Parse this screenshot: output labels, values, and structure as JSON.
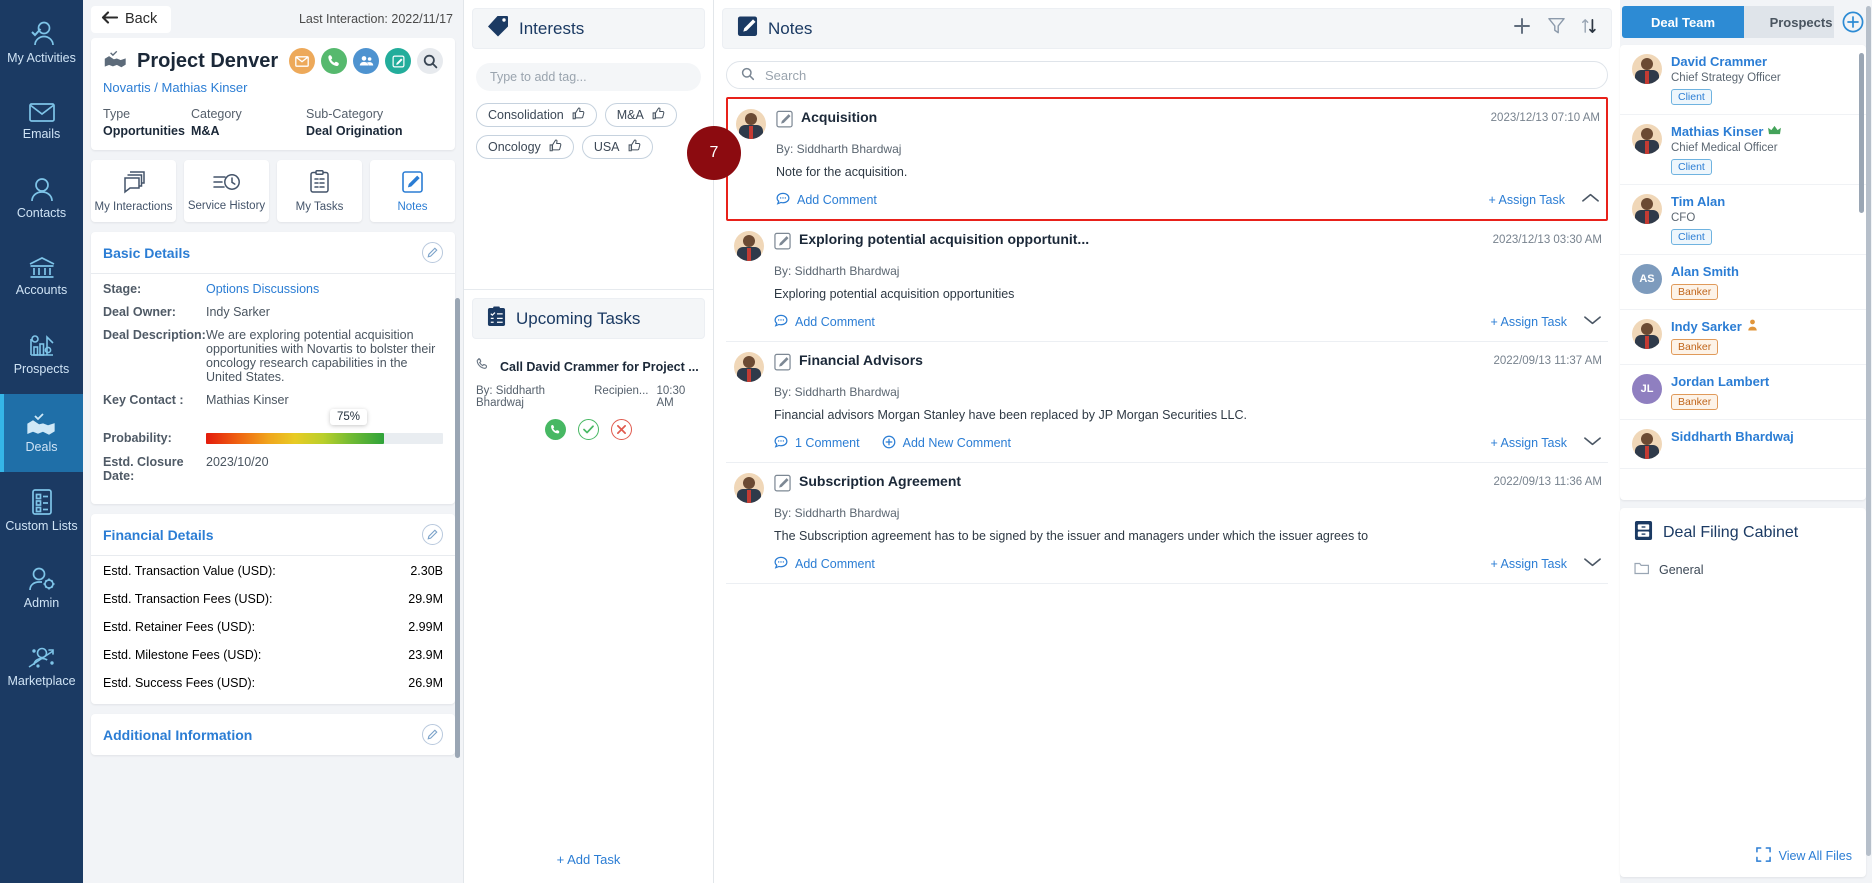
{
  "sidebar": {
    "items": [
      {
        "label": "My Activities",
        "icon": "user-check-icon",
        "active": false
      },
      {
        "label": "Emails",
        "icon": "envelope-icon",
        "active": false
      },
      {
        "label": "Contacts",
        "icon": "user-icon",
        "active": false
      },
      {
        "label": "Accounts",
        "icon": "bank-icon",
        "active": false
      },
      {
        "label": "Prospects",
        "icon": "chart-gear-icon",
        "active": false
      },
      {
        "label": "Deals",
        "icon": "handshake-check-icon",
        "active": true
      },
      {
        "label": "Custom Lists",
        "icon": "list-icon",
        "active": false
      },
      {
        "label": "Admin",
        "icon": "user-gear-icon",
        "active": false
      },
      {
        "label": "Marketplace",
        "icon": "marketplace-icon",
        "active": false
      }
    ]
  },
  "topbar": {
    "back_label": "Back",
    "last_interaction": "Last Interaction: 2022/11/17"
  },
  "deal": {
    "title": "Project Denver",
    "breadcrumb": "Novartis / Mathias Kinser",
    "meta": [
      {
        "key": "Type",
        "value": "Opportunities"
      },
      {
        "key": "Category",
        "value": "M&A"
      },
      {
        "key": "Sub-Category",
        "value": "Deal Origination"
      }
    ],
    "action_icons": [
      "email-icon",
      "phone-icon",
      "meeting-icon",
      "note-icon",
      "search-icon"
    ],
    "tabs": [
      {
        "label": "My Interactions",
        "icon": "interactions-icon",
        "active": false
      },
      {
        "label": "Service History",
        "icon": "history-icon",
        "active": false
      },
      {
        "label": "My Tasks",
        "icon": "tasks-icon",
        "active": false
      },
      {
        "label": "Notes",
        "icon": "notes-icon",
        "active": true
      }
    ],
    "basic_details": {
      "title": "Basic Details",
      "rows": [
        {
          "key": "Stage:",
          "value": "Options Discussions",
          "link": true
        },
        {
          "key": "Deal Owner:",
          "value": "Indy Sarker",
          "link": false
        },
        {
          "key": "Deal Description:",
          "value": "We are exploring potential acquisition opportunities with Novartis to bolster their oncology research capabilities in the United States.",
          "link": false
        },
        {
          "key": "Key Contact :",
          "value": "Mathias Kinser",
          "link": false
        }
      ],
      "probability_label": "Probability:",
      "probability_value": "75%",
      "probability_pct": 75,
      "closure_label": "Estd. Closure Date:",
      "closure_value": "2023/10/20"
    },
    "financial_details": {
      "title": "Financial Details",
      "rows": [
        {
          "key": "Estd. Transaction Value (USD):",
          "value": "2.30B"
        },
        {
          "key": "Estd. Transaction Fees (USD):",
          "value": "29.9M"
        },
        {
          "key": "Estd. Retainer Fees (USD):",
          "value": "2.99M"
        },
        {
          "key": "Estd. Milestone Fees (USD):",
          "value": "23.9M"
        },
        {
          "key": "Estd. Success Fees (USD):",
          "value": "26.9M"
        }
      ]
    },
    "additional_information": {
      "title": "Additional Information"
    }
  },
  "interests": {
    "title": "Interests",
    "input_placeholder": "Type to add tag...",
    "tags": [
      "Consolidation",
      "M&A",
      "Oncology",
      "USA"
    ]
  },
  "upcoming_tasks": {
    "title": "Upcoming Tasks",
    "task_name": "Call David Crammer for Project ...",
    "by_label": "By: Siddharth Bhardwaj",
    "recipient_label": "Recipien...",
    "time": "10:30 AM",
    "add_task_label": "+ Add Task"
  },
  "notes": {
    "title": "Notes",
    "search_placeholder": "Search",
    "tools": [
      "add-icon",
      "filter-icon",
      "sort-icon"
    ],
    "badge_count": "7",
    "items": [
      {
        "title": "Acquisition",
        "date": "2023/12/13 07:10 AM",
        "by": "By: Siddharth Bhardwaj",
        "body": "Note for the acquisition.",
        "comment_label": "Add Comment",
        "assign_label": "+ Assign Task",
        "expanded": true,
        "highlighted": true,
        "avatar_type": "photo"
      },
      {
        "title": "Exploring potential acquisition opportunit...",
        "date": "2023/12/13 03:30 AM",
        "by": "By: Siddharth Bhardwaj",
        "body": "Exploring potential acquisition opportunities",
        "comment_label": "Add Comment",
        "assign_label": "+ Assign Task",
        "expanded": false,
        "highlighted": false,
        "avatar_type": "photo"
      },
      {
        "title": "Financial Advisors",
        "date": "2022/09/13 11:37 AM",
        "by": "By: Siddharth Bhardwaj",
        "body": "Financial advisors Morgan Stanley have been replaced by JP Morgan Securities LLC.",
        "comment_label": "1 Comment",
        "new_comment_label": "Add New Comment",
        "assign_label": "+ Assign Task",
        "expanded": false,
        "highlighted": false,
        "avatar_type": "photo"
      },
      {
        "title": "Subscription Agreement",
        "date": "2022/09/13 11:36 AM",
        "by": "By: Siddharth Bhardwaj",
        "body": "The Subscription agreement has to be signed by the issuer and managers under which the issuer agrees to",
        "comment_label": "Add Comment",
        "assign_label": "+ Assign Task",
        "expanded": false,
        "highlighted": false,
        "avatar_type": "photo"
      }
    ]
  },
  "deal_team": {
    "tab_active": "Deal Team",
    "tab_inactive": "Prospects",
    "add_label": "add-member-icon",
    "members": [
      {
        "name": "David Crammer",
        "role": "Chief Strategy Officer",
        "badge": "Client",
        "badge_type": "client",
        "avatar_type": "photo",
        "initials": "",
        "color": "#5b8fc9",
        "crown": false,
        "star": false
      },
      {
        "name": "Mathias Kinser",
        "role": "Chief Medical Officer",
        "badge": "Client",
        "badge_type": "client",
        "avatar_type": "photo",
        "initials": "",
        "color": "#5b8fc9",
        "crown": true,
        "star": false
      },
      {
        "name": "Tim Alan",
        "role": "CFO",
        "badge": "Client",
        "badge_type": "client",
        "avatar_type": "photo",
        "initials": "",
        "color": "#5b8fc9",
        "crown": false,
        "star": false
      },
      {
        "name": "Alan Smith",
        "role": "",
        "badge": "Banker",
        "badge_type": "banker",
        "avatar_type": "initials",
        "initials": "AS",
        "color": "#7d9bbd",
        "crown": false,
        "star": false
      },
      {
        "name": "Indy Sarker",
        "role": "",
        "badge": "Banker",
        "badge_type": "banker",
        "avatar_type": "photo",
        "initials": "",
        "color": "#5b8fc9",
        "crown": false,
        "star": true
      },
      {
        "name": "Jordan Lambert",
        "role": "",
        "badge": "Banker",
        "badge_type": "banker",
        "avatar_type": "initials",
        "initials": "JL",
        "color": "#8f7fc0",
        "crown": false,
        "star": false
      },
      {
        "name": "Siddharth Bhardwaj",
        "role": "",
        "badge": "",
        "badge_type": "",
        "avatar_type": "photo",
        "initials": "",
        "color": "#5b8fc9",
        "crown": false,
        "star": false
      }
    ],
    "filing_cabinet": {
      "title": "Deal Filing Cabinet",
      "folders": [
        "General"
      ],
      "view_all_label": "View All Files"
    }
  },
  "colors": {
    "nav_bg": "#1b3a63",
    "nav_active": "#1f6fa8",
    "accent_blue": "#2b7dd4",
    "highlight_red": "#e8211a",
    "badge_red": "#8c0b10"
  }
}
